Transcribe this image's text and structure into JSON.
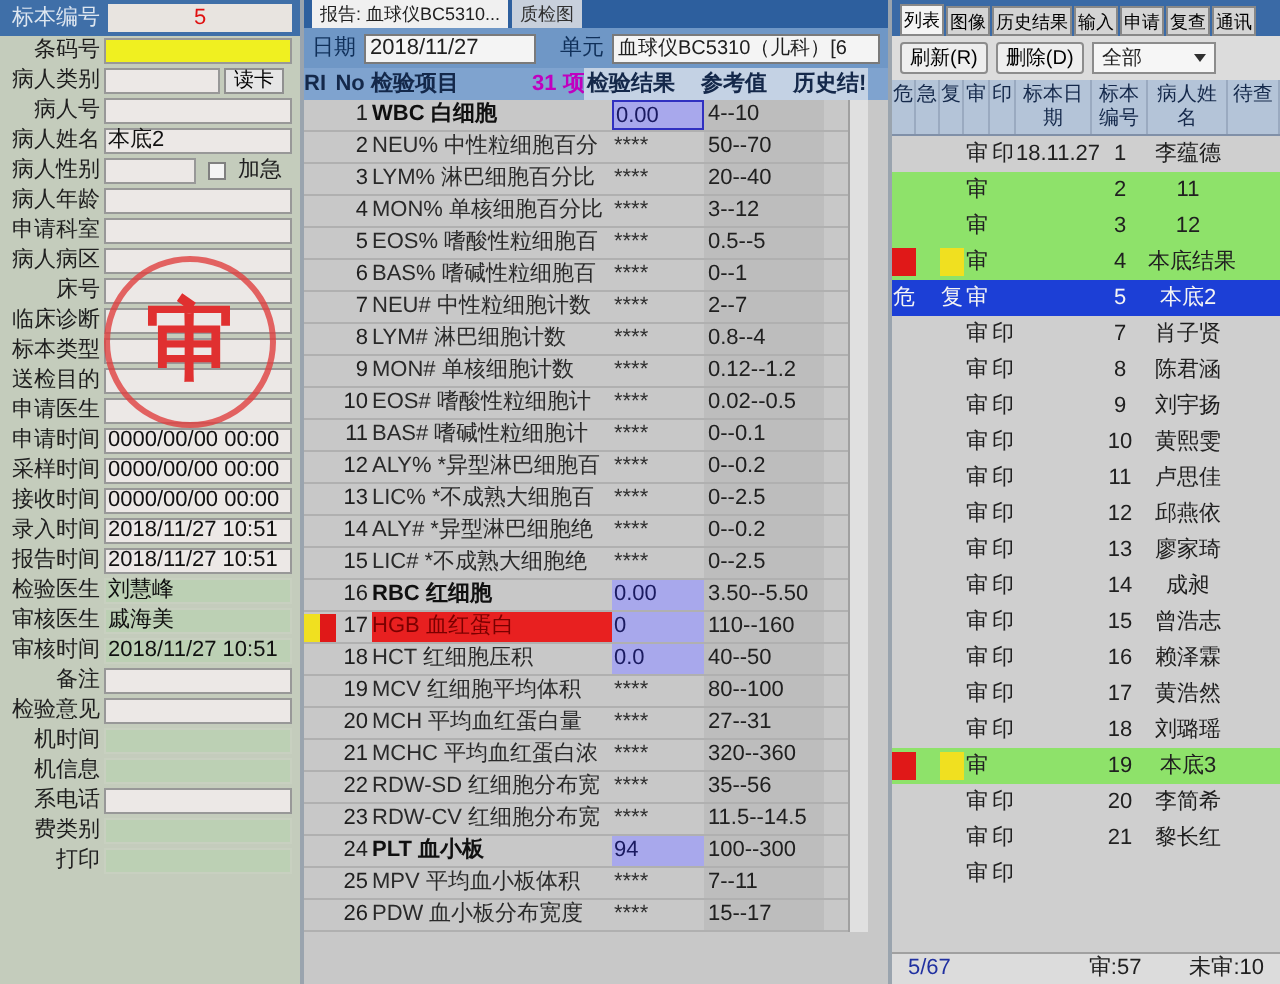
{
  "left_panel": {
    "header": {
      "label": "标本编号",
      "value": "5"
    },
    "fields": [
      {
        "label": "条码号",
        "kind": "text",
        "highlighted": true,
        "readonly": false
      },
      {
        "label": "病人类别",
        "kind": "button",
        "button": "读卡",
        "highlighted": false,
        "readonly": false
      },
      {
        "label": "病人号",
        "kind": "text",
        "highlighted": false,
        "readonly": false
      },
      {
        "label": "病人姓名",
        "kind": "text",
        "value": "本底2",
        "highlighted": false,
        "readonly": false
      },
      {
        "label": "病人性别",
        "kind": "checkbox",
        "checkbox": {
          "label": "加急",
          "checked": false
        },
        "highlighted": false,
        "readonly": false
      },
      {
        "label": "病人年龄",
        "kind": "text",
        "highlighted": false,
        "readonly": false
      },
      {
        "label": "申请科室",
        "kind": "text",
        "highlighted": false,
        "readonly": false
      },
      {
        "label": "病人病区",
        "kind": "text",
        "highlighted": false,
        "readonly": false
      },
      {
        "label": "床号",
        "kind": "text",
        "highlighted": false,
        "readonly": false
      },
      {
        "label": "临床诊断",
        "kind": "text",
        "highlighted": false,
        "readonly": false
      },
      {
        "label": "标本类型",
        "kind": "text",
        "highlighted": false,
        "readonly": false
      },
      {
        "label": "送检目的",
        "kind": "text",
        "highlighted": false,
        "readonly": false
      },
      {
        "label": "申请医生",
        "kind": "text",
        "highlighted": false,
        "readonly": false
      },
      {
        "label": "申请时间",
        "kind": "text",
        "value": "0000/00/00 00:00",
        "highlighted": false,
        "readonly": false
      },
      {
        "label": "采样时间",
        "kind": "text",
        "value": "0000/00/00 00:00",
        "highlighted": false,
        "readonly": false
      },
      {
        "label": "接收时间",
        "kind": "text",
        "value": "0000/00/00 00:00",
        "highlighted": false,
        "readonly": false
      },
      {
        "label": "录入时间",
        "kind": "text",
        "value": "2018/11/27 10:51",
        "highlighted": false,
        "readonly": false
      },
      {
        "label": "报告时间",
        "kind": "text",
        "value": "2018/11/27 10:51",
        "highlighted": false,
        "readonly": false
      },
      {
        "label": "检验医生",
        "kind": "text",
        "value": "刘慧峰",
        "highlighted": false,
        "readonly": true
      },
      {
        "label": "审核医生",
        "kind": "text",
        "value": "戚海美",
        "highlighted": false,
        "readonly": true
      },
      {
        "label": "审核时间",
        "kind": "text",
        "value": "2018/11/27 10:51",
        "highlighted": false,
        "readonly": true
      },
      {
        "label": "备注",
        "kind": "text",
        "highlighted": false,
        "readonly": false
      },
      {
        "label": "检验意见",
        "kind": "text",
        "highlighted": false,
        "readonly": false
      },
      {
        "label": "机时间",
        "kind": "text",
        "highlighted": false,
        "readonly": true
      },
      {
        "label": "机信息",
        "kind": "text",
        "highlighted": false,
        "readonly": true
      },
      {
        "label": "系电话",
        "kind": "text",
        "highlighted": false,
        "readonly": false
      },
      {
        "label": "费类别",
        "kind": "text",
        "highlighted": false,
        "readonly": true
      },
      {
        "label": "打印",
        "kind": "text",
        "highlighted": false,
        "readonly": true
      }
    ],
    "stamp": "审"
  },
  "middle_panel": {
    "tabs": [
      {
        "label": "报告: 血球仪BC5310...",
        "selected": true
      },
      {
        "label": "质检图",
        "selected": false
      }
    ],
    "date": {
      "label": "日期",
      "value": "2018/11/27"
    },
    "unit": {
      "label": "单元",
      "value": "血球仪BC5310（儿科）[6"
    },
    "columns": [
      "R",
      "I",
      "No",
      "检验项目",
      "31 项",
      "检验结果",
      "参考值",
      "历史结!"
    ],
    "rows": [
      {
        "no": "1",
        "item": "WBC 白细胞",
        "bold": true,
        "result": "0.00",
        "entered": true,
        "selected": true,
        "abnormal": false,
        "reference": "4--10"
      },
      {
        "no": "2",
        "item": "NEU% 中性粒细胞百分",
        "bold": false,
        "result": "****",
        "entered": false,
        "selected": false,
        "abnormal": false,
        "reference": "50--70"
      },
      {
        "no": "3",
        "item": "LYM% 淋巴细胞百分比",
        "bold": false,
        "result": "****",
        "entered": false,
        "selected": false,
        "abnormal": false,
        "reference": "20--40"
      },
      {
        "no": "4",
        "item": "MON% 单核细胞百分比",
        "bold": false,
        "result": "****",
        "entered": false,
        "selected": false,
        "abnormal": false,
        "reference": "3--12"
      },
      {
        "no": "5",
        "item": "EOS% 嗜酸性粒细胞百",
        "bold": false,
        "result": "****",
        "entered": false,
        "selected": false,
        "abnormal": false,
        "reference": "0.5--5"
      },
      {
        "no": "6",
        "item": "BAS% 嗜碱性粒细胞百",
        "bold": false,
        "result": "****",
        "entered": false,
        "selected": false,
        "abnormal": false,
        "reference": "0--1"
      },
      {
        "no": "7",
        "item": "NEU# 中性粒细胞计数",
        "bold": false,
        "result": "****",
        "entered": false,
        "selected": false,
        "abnormal": false,
        "reference": "2--7"
      },
      {
        "no": "8",
        "item": "LYM# 淋巴细胞计数",
        "bold": false,
        "result": "****",
        "entered": false,
        "selected": false,
        "abnormal": false,
        "reference": "0.8--4"
      },
      {
        "no": "9",
        "item": "MON# 单核细胞计数",
        "bold": false,
        "result": "****",
        "entered": false,
        "selected": false,
        "abnormal": false,
        "reference": "0.12--1.2"
      },
      {
        "no": "10",
        "item": "EOS# 嗜酸性粒细胞计",
        "bold": false,
        "result": "****",
        "entered": false,
        "selected": false,
        "abnormal": false,
        "reference": "0.02--0.5"
      },
      {
        "no": "11",
        "item": "BAS# 嗜碱性粒细胞计",
        "bold": false,
        "result": "****",
        "entered": false,
        "selected": false,
        "abnormal": false,
        "reference": "0--0.1"
      },
      {
        "no": "12",
        "item": "ALY% *异型淋巴细胞百",
        "bold": false,
        "result": "****",
        "entered": false,
        "selected": false,
        "abnormal": false,
        "reference": "0--0.2"
      },
      {
        "no": "13",
        "item": "LIC% *不成熟大细胞百",
        "bold": false,
        "result": "****",
        "entered": false,
        "selected": false,
        "abnormal": false,
        "reference": "0--2.5"
      },
      {
        "no": "14",
        "item": "ALY# *异型淋巴细胞绝",
        "bold": false,
        "result": "****",
        "entered": false,
        "selected": false,
        "abnormal": false,
        "reference": "0--0.2"
      },
      {
        "no": "15",
        "item": "LIC# *不成熟大细胞绝",
        "bold": false,
        "result": "****",
        "entered": false,
        "selected": false,
        "abnormal": false,
        "reference": "0--2.5"
      },
      {
        "no": "16",
        "item": "RBC 红细胞",
        "bold": true,
        "result": "0.00",
        "entered": true,
        "selected": false,
        "abnormal": false,
        "reference": "3.50--5.50"
      },
      {
        "no": "17",
        "item": "HGB 血红蛋白",
        "bold": false,
        "result": "0",
        "entered": true,
        "selected": false,
        "abnormal": true,
        "markers": {
          "r": {
            "color": "#f0e020"
          },
          "i": {
            "color": "#e01818"
          }
        },
        "reference": "110--160"
      },
      {
        "no": "18",
        "item": "HCT 红细胞压积",
        "bold": false,
        "result": "0.0",
        "entered": true,
        "selected": false,
        "abnormal": false,
        "reference": "40--50"
      },
      {
        "no": "19",
        "item": "MCV 红细胞平均体积",
        "bold": false,
        "result": "****",
        "entered": false,
        "selected": false,
        "abnormal": false,
        "reference": "80--100"
      },
      {
        "no": "20",
        "item": "MCH 平均血红蛋白量",
        "bold": false,
        "result": "****",
        "entered": false,
        "selected": false,
        "abnormal": false,
        "reference": "27--31"
      },
      {
        "no": "21",
        "item": "MCHC 平均血红蛋白浓",
        "bold": false,
        "result": "****",
        "entered": false,
        "selected": false,
        "abnormal": false,
        "reference": "320--360"
      },
      {
        "no": "22",
        "item": "RDW-SD 红细胞分布宽",
        "bold": false,
        "result": "****",
        "entered": false,
        "selected": false,
        "abnormal": false,
        "reference": "35--56"
      },
      {
        "no": "23",
        "item": "RDW-CV 红细胞分布宽",
        "bold": false,
        "result": "****",
        "entered": false,
        "selected": false,
        "abnormal": false,
        "reference": "11.5--14.5"
      },
      {
        "no": "24",
        "item": "PLT 血小板",
        "bold": true,
        "result": "94",
        "entered": true,
        "selected": false,
        "abnormal": false,
        "reference": "100--300"
      },
      {
        "no": "25",
        "item": "MPV 平均血小板体积",
        "bold": false,
        "result": "****",
        "entered": false,
        "selected": false,
        "abnormal": false,
        "reference": "7--11"
      },
      {
        "no": "26",
        "item": "PDW 血小板分布宽度",
        "bold": false,
        "result": "****",
        "entered": false,
        "selected": false,
        "abnormal": false,
        "reference": "15--17"
      }
    ]
  },
  "right_panel": {
    "tabs": [
      {
        "label": "列表",
        "selected": true
      },
      {
        "label": "图像",
        "selected": false
      },
      {
        "label": "历史结果",
        "selected": false
      },
      {
        "label": "输入",
        "selected": false
      },
      {
        "label": "申请",
        "selected": false
      },
      {
        "label": "复查",
        "selected": false
      },
      {
        "label": "通讯",
        "selected": false
      }
    ],
    "buttons": [
      "刷新(R)",
      "删除(D)"
    ],
    "filter": {
      "value": "全部"
    },
    "columns": [
      "危",
      "急",
      "复",
      "审",
      "印",
      "标本日期",
      "标本编号",
      "病人姓名",
      "待查"
    ],
    "rows": [
      {
        "audit": "审",
        "print": "印",
        "date": "18.11.27",
        "number": "1",
        "name": "李蕴德",
        "selected": false
      },
      {
        "audit": "审",
        "number": "2",
        "name": "11",
        "color": "#8ee26a",
        "selected": false
      },
      {
        "audit": "审",
        "number": "3",
        "name": "12",
        "color": "#8ee26a",
        "selected": false
      },
      {
        "audit": "审",
        "number": "4",
        "name": "本底结果",
        "color": "#8ee26a",
        "markers": {
          "danger": {
            "color": "#e01818"
          },
          "recheck": {
            "color": "#f0e020"
          }
        },
        "selected": false
      },
      {
        "danger": "危",
        "recheck": "复",
        "audit": "审",
        "number": "5",
        "name": "本底2",
        "selected": true
      },
      {
        "audit": "审",
        "print": "印",
        "number": "7",
        "name": "肖子贤",
        "selected": false
      },
      {
        "audit": "审",
        "print": "印",
        "number": "8",
        "name": "陈君涵",
        "selected": false
      },
      {
        "audit": "审",
        "print": "印",
        "number": "9",
        "name": "刘宇扬",
        "selected": false
      },
      {
        "audit": "审",
        "print": "印",
        "number": "10",
        "name": "黄熙雯",
        "selected": false
      },
      {
        "audit": "审",
        "print": "印",
        "number": "11",
        "name": "卢思佳",
        "selected": false
      },
      {
        "audit": "审",
        "print": "印",
        "number": "12",
        "name": "邱燕依",
        "selected": false
      },
      {
        "audit": "审",
        "print": "印",
        "number": "13",
        "name": "廖家琦",
        "selected": false
      },
      {
        "audit": "审",
        "print": "印",
        "number": "14",
        "name": "成昶",
        "selected": false
      },
      {
        "audit": "审",
        "print": "印",
        "number": "15",
        "name": "曾浩志",
        "selected": false
      },
      {
        "audit": "审",
        "print": "印",
        "number": "16",
        "name": "赖泽霖",
        "selected": false
      },
      {
        "audit": "审",
        "print": "印",
        "number": "17",
        "name": "黄浩然",
        "selected": false
      },
      {
        "audit": "审",
        "print": "印",
        "number": "18",
        "name": "刘璐瑶",
        "selected": false
      },
      {
        "audit": "审",
        "number": "19",
        "name": "本底3",
        "color": "#8ee26a",
        "markers": {
          "danger": {
            "color": "#e01818"
          },
          "recheck": {
            "color": "#f0e020"
          }
        },
        "selected": false
      },
      {
        "audit": "审",
        "print": "印",
        "number": "20",
        "name": "李简希",
        "selected": false
      },
      {
        "audit": "审",
        "print": "印",
        "number": "21",
        "name": "黎长红",
        "selected": false
      },
      {
        "audit": "审",
        "print": "印",
        "selected": false
      }
    ],
    "status_bar": {
      "position": "5/67",
      "audited": "审:57",
      "unaudited": "未审:10"
    }
  }
}
